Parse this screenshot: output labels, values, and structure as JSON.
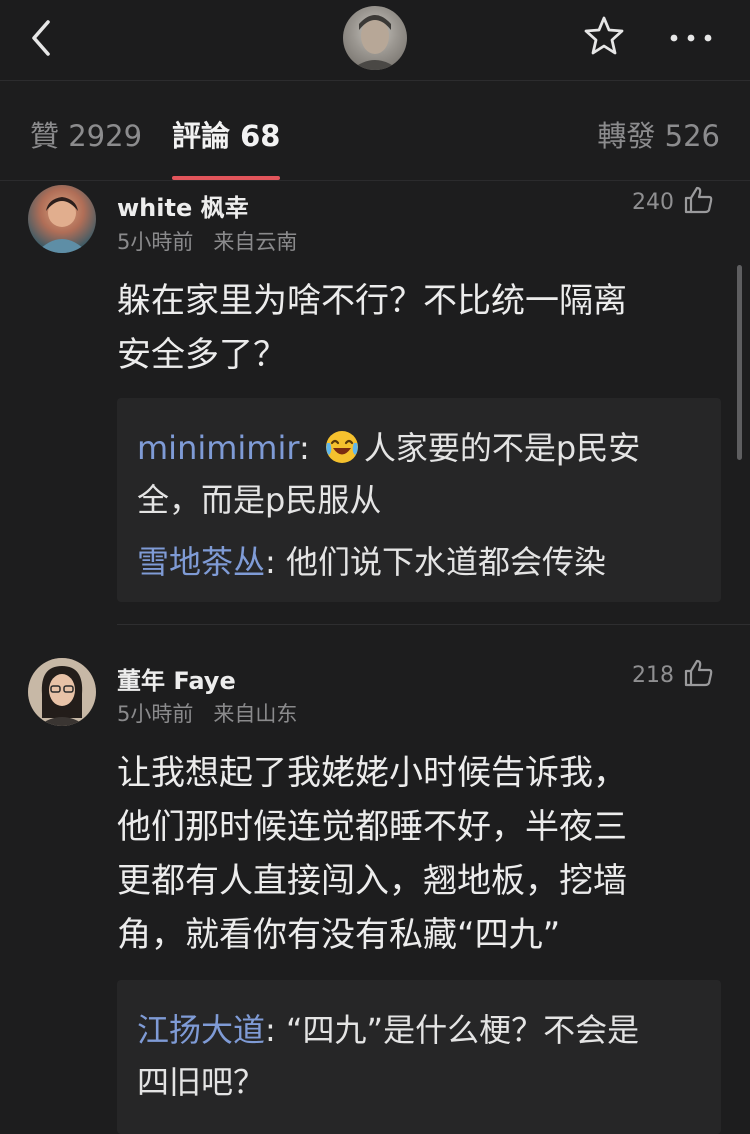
{
  "header": {
    "back_icon": "chevron-left-icon",
    "star_icon": "star-outline-icon",
    "more_icon": "more-dots-icon"
  },
  "tabs": {
    "like": "贊 2929",
    "comment": "評論 68",
    "repost": "轉發 526"
  },
  "comments": [
    {
      "user": "white 枫幸",
      "time": "5小時前",
      "region": "来自云南",
      "likes": "240",
      "text_lines": [
        "躲在家里为啥不行？不比统一隔离",
        "安全多了？"
      ],
      "replies": [
        {
          "name": "minimimir",
          "sep": ": ",
          "lines": [
            "人家要的不是p民安",
            "全，而是p民服从"
          ],
          "emoji": "laughing-crying-emoji"
        },
        {
          "name": "雪地茶丛",
          "sep": ": ",
          "lines": [
            "他们说下水道都会传染"
          ]
        }
      ]
    },
    {
      "user": "董年 Faye",
      "time": "5小時前",
      "region": "来自山东",
      "likes": "218",
      "text_lines": [
        "让我想起了我姥姥小时候告诉我，",
        "他们那时候连觉都睡不好，半夜三",
        "更都有人直接闯入，翘地板，挖墙",
        "角，就看你有没有私藏“四九”"
      ],
      "replies": [
        {
          "name": "江扬大道",
          "sep": ": ",
          "lines": [
            "“四九”是什么梗？不会是",
            "四旧吧？"
          ]
        }
      ]
    }
  ],
  "colors": {
    "background": "#1d1d1e",
    "accent": "#e2555b",
    "reply_name": "#7f9bd6",
    "muted": "#8a8a8c"
  }
}
